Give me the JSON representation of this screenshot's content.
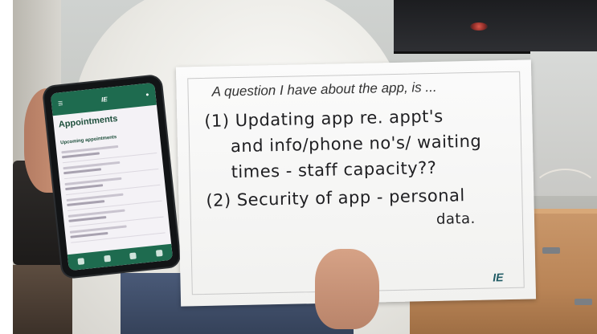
{
  "sign": {
    "prompt": "A question I have about the app, is ...",
    "lines": [
      "(1) Updating app re. appt's",
      "and info/phone no's/ waiting",
      "times - staff capacity??",
      "(2) Security of app - personal",
      "data."
    ],
    "logo": "IE"
  },
  "phone": {
    "app_logo": "IE",
    "screen_title": "Appointments",
    "section_heading": "Upcoming appointments"
  }
}
